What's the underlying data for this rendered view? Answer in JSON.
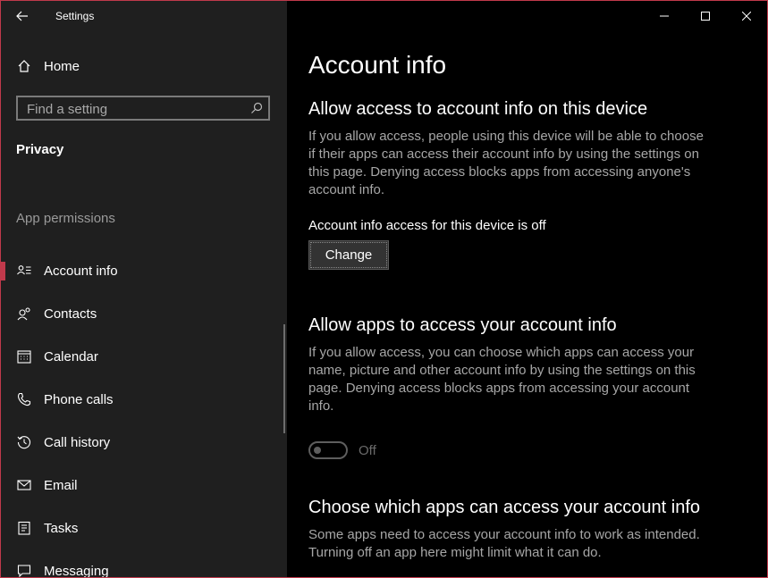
{
  "window": {
    "title": "Settings",
    "accent_color": "#c0394b"
  },
  "sidebar": {
    "home_label": "Home",
    "search_placeholder": "Find a setting",
    "section_title": "Privacy",
    "group_title": "App permissions",
    "items": [
      {
        "label": "Account info",
        "icon": "account-info-icon",
        "selected": true
      },
      {
        "label": "Contacts",
        "icon": "contacts-icon"
      },
      {
        "label": "Calendar",
        "icon": "calendar-icon"
      },
      {
        "label": "Phone calls",
        "icon": "phone-icon"
      },
      {
        "label": "Call history",
        "icon": "call-history-icon"
      },
      {
        "label": "Email",
        "icon": "email-icon"
      },
      {
        "label": "Tasks",
        "icon": "tasks-icon"
      },
      {
        "label": "Messaging",
        "icon": "messaging-icon"
      }
    ]
  },
  "main": {
    "title": "Account info",
    "device_section": {
      "heading": "Allow access to account info on this device",
      "description": "If you allow access, people using this device will be able to choose if their apps can access their account info by using the settings on this page. Denying access blocks apps from accessing anyone's account info.",
      "status": "Account info access for this device is off",
      "button_label": "Change"
    },
    "apps_section": {
      "heading": "Allow apps to access your account info",
      "description": "If you allow access, you can choose which apps can access your name, picture and other account info by using the settings on this page. Denying access blocks apps from accessing your account info.",
      "toggle_state": "Off"
    },
    "choose_section": {
      "heading": "Choose which apps can access your account info",
      "description": "Some apps need to access your account info to work as intended. Turning off an app here might limit what it can do."
    }
  }
}
